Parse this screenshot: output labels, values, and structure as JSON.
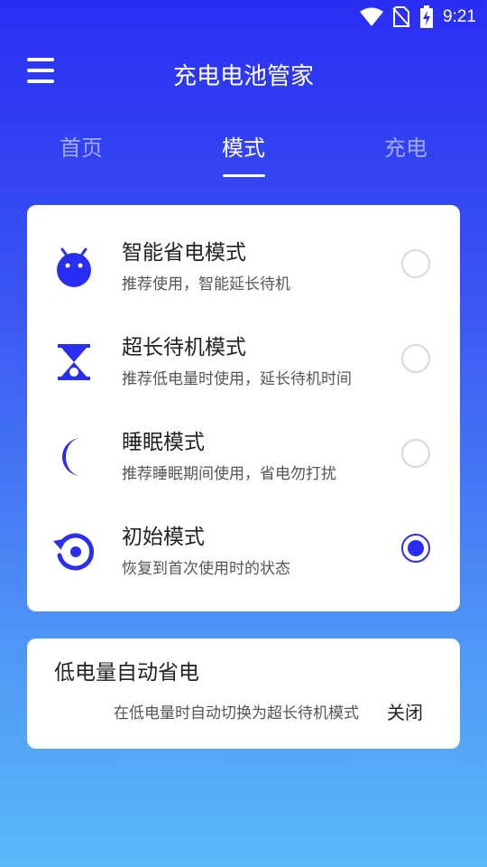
{
  "status_bar": {
    "time": "9:21",
    "icons": [
      "wifi-icon",
      "no-sim-icon",
      "battery-charging-icon"
    ]
  },
  "app_bar": {
    "title": "充电电池管家",
    "menu_icon": "menu-icon"
  },
  "tabs": [
    {
      "label": "首页",
      "active": false
    },
    {
      "label": "模式",
      "active": true
    },
    {
      "label": "充电",
      "active": false
    }
  ],
  "modes": [
    {
      "icon": "android-icon",
      "title": "智能省电模式",
      "desc": "推荐使用，智能延长待机",
      "selected": false
    },
    {
      "icon": "hourglass-icon",
      "title": "超长待机模式",
      "desc": "推荐低电量时使用，延长待机时间",
      "selected": false
    },
    {
      "icon": "moon-icon",
      "title": "睡眠模式",
      "desc": "推荐睡眠期间使用，省电勿打扰",
      "selected": false
    },
    {
      "icon": "reset-icon",
      "title": "初始模式",
      "desc": "恢复到首次使用时的状态",
      "selected": true
    }
  ],
  "low_battery": {
    "title": "低电量自动省电",
    "desc": "在低电量时自动切换为超长待机模式",
    "toggle_label": "关闭"
  },
  "colors": {
    "accent": "#2a2ef2",
    "gradient_top": "#2a2ef2",
    "gradient_bottom": "#5ab9f8"
  }
}
